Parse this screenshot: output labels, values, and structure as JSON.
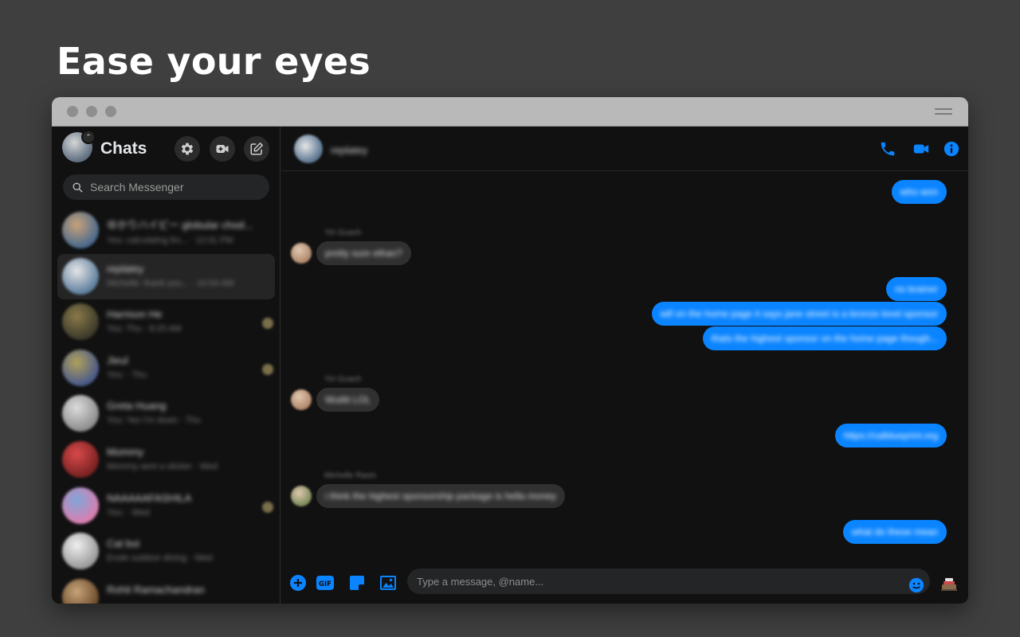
{
  "headline": "Ease your eyes",
  "colors": {
    "accent": "#0a84ff",
    "background": "#3f3f3f",
    "panel": "#111111"
  },
  "sidebar": {
    "title": "Chats",
    "buttons": [
      "gear-icon",
      "video-plus-icon",
      "compose-icon"
    ],
    "search_placeholder": "Search Messenger",
    "chats": [
      {
        "name": "ゆかりハイビー globular chod...",
        "snippet": "You: calculating fro... · 12:01 PM",
        "colorA": "#c9a27a",
        "colorB": "#4a6a8c",
        "active": false,
        "seen": false
      },
      {
        "name": "replatey",
        "snippet": "Michelle: thank you... · 10:54 AM",
        "colorA": "#e6e6e6",
        "colorB": "#5f7f9e",
        "active": true,
        "seen": false
      },
      {
        "name": "Harrison He",
        "snippet": "You: Thu · 8:25 AM",
        "colorA": "#8a7a4a",
        "colorB": "#3c3a2a",
        "active": false,
        "seen": true
      },
      {
        "name": "Jieul",
        "snippet": "You: · Thu",
        "colorA": "#b1a15a",
        "colorB": "#4a5a8a",
        "active": false,
        "seen": true
      },
      {
        "name": "Greta Huang",
        "snippet": "You: Yes I'm down · Thu",
        "colorA": "#dcdcdc",
        "colorB": "#8e8e8e",
        "active": false,
        "seen": false
      },
      {
        "name": "Mommy",
        "snippet": "Mommy sent a sticker · Wed",
        "colorA": "#d94a4a",
        "colorB": "#7a2222",
        "active": false,
        "seen": false
      },
      {
        "name": "NAAAAAFASHILA",
        "snippet": "You: · Wed",
        "colorA": "#7fa6d9",
        "colorB": "#d97fb0",
        "active": false,
        "seen": true
      },
      {
        "name": "Cat boi",
        "snippet": "Ensle outdoor dining · Wed",
        "colorA": "#f0f0f0",
        "colorB": "#9a9a9a",
        "active": false,
        "seen": false
      },
      {
        "name": "Rohit Ramachandran",
        "snippet": "",
        "colorA": "#c8a47a",
        "colorB": "#6a4a2a",
        "active": false,
        "seen": false
      }
    ]
  },
  "conversation": {
    "name": "replatey",
    "header_icons": [
      "phone-icon",
      "video-icon",
      "info-icon"
    ],
    "messages": [
      {
        "dir": "out",
        "text": "who won"
      },
      {
        "dir": "in",
        "sender": "Yiri Guach",
        "text": "pretty sure ethan?"
      },
      {
        "dir": "out",
        "text": "no brainer"
      },
      {
        "dir": "out",
        "text": "wtf on the home page it says jane street is a bronze level sponsor"
      },
      {
        "dir": "out",
        "text": "thats the highest sponsor on the home page though..."
      },
      {
        "dir": "in",
        "sender": "Yiri Guach",
        "text": "Wutttt LOL"
      },
      {
        "dir": "out",
        "text": "https://calblueprint.org"
      },
      {
        "dir": "in",
        "sender": "Michelle Rasin",
        "text": "i think the highest sponsorship package is hella money"
      },
      {
        "dir": "out",
        "text": "what do these mean"
      }
    ],
    "composer_placeholder": "Type a message, @name..."
  }
}
